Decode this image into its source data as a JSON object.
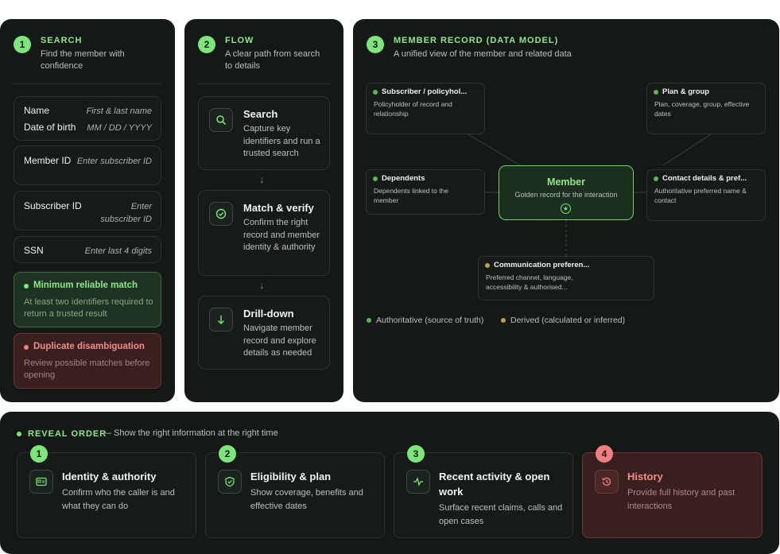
{
  "colors": {
    "accent": "#7ee57c",
    "danger": "#f07f7f",
    "derived": "#b7a24a",
    "panel": "#141817"
  },
  "search": {
    "num": "1",
    "title": "SEARCH",
    "subtitle": "Find the member with confidence",
    "fields": [
      {
        "label": "Name",
        "placeholder": "First & last name"
      },
      {
        "label": "Date of birth",
        "placeholder": "MM / DD / YYYY"
      },
      {
        "label": "Member ID",
        "placeholder": "Enter subscriber ID"
      },
      {
        "label": "Subscriber ID",
        "placeholder": "Enter subscriber ID"
      },
      {
        "label": "SSN",
        "placeholder": "Enter last 4 digits"
      }
    ],
    "min_match": {
      "title": "Minimum reliable match",
      "text": "At least two identifiers required to return a trusted result"
    },
    "duplicate": {
      "title": "Duplicate disambiguation",
      "text": "Review possible matches before opening"
    }
  },
  "flow": {
    "num": "2",
    "title": "FLOW",
    "subtitle": "A clear path from search to details",
    "steps": [
      {
        "icon": "search-icon",
        "title": "Search",
        "text": "Capture key identifiers and run a trusted search"
      },
      {
        "icon": "check-circle-icon",
        "title": "Match & verify",
        "text": "Confirm the right record and member identity & authority"
      },
      {
        "icon": "arrow-down-icon",
        "title": "Drill-down",
        "text": "Navigate member record and explore details as needed"
      }
    ]
  },
  "model": {
    "num": "3",
    "title": "MEMBER RECORD (DATA MODEL)",
    "subtitle": "A unified view of the member and related data",
    "center": {
      "title": "Member",
      "text": "Golden record for the interaction"
    },
    "nodes": {
      "subscriber": {
        "title": "Subscriber / policyhol...",
        "text": "Policyholder of record and relationship",
        "kind": "authoritative"
      },
      "plan": {
        "title": "Plan & group",
        "text": "Plan, coverage, group, effective dates",
        "kind": "authoritative"
      },
      "dependents": {
        "title": "Dependents",
        "text": "Dependents linked to the member",
        "kind": "authoritative"
      },
      "contact": {
        "title": "Contact details & pref...",
        "text": "Authoritative preferred name & contact",
        "kind": "authoritative"
      },
      "communication": {
        "title": "Communication preferen...",
        "text": "Preferred channel, language, accessibility & authorised...",
        "kind": "derived"
      }
    },
    "legend": [
      {
        "label": "Authoritative (source of truth)",
        "color": "#5fb35a"
      },
      {
        "label": "Derived (calculated or inferred)",
        "color": "#b7a24a"
      }
    ]
  },
  "reveal": {
    "title": "REVEAL ORDER",
    "subtitle": "— Show the right information at the right time",
    "items": [
      {
        "num": "1",
        "icon": "id-card-icon",
        "title": "Identity & authority",
        "text": "Confirm who the caller is and what they can do"
      },
      {
        "num": "2",
        "icon": "shield-check-icon",
        "title": "Eligibility & plan",
        "text": "Show coverage, benefits and effective dates"
      },
      {
        "num": "3",
        "icon": "activity-icon",
        "title": "Recent activity & open work",
        "text": "Surface recent claims, calls and open cases"
      },
      {
        "num": "4",
        "icon": "history-icon",
        "title": "History",
        "text": "Provide full history and past interactions"
      }
    ]
  }
}
